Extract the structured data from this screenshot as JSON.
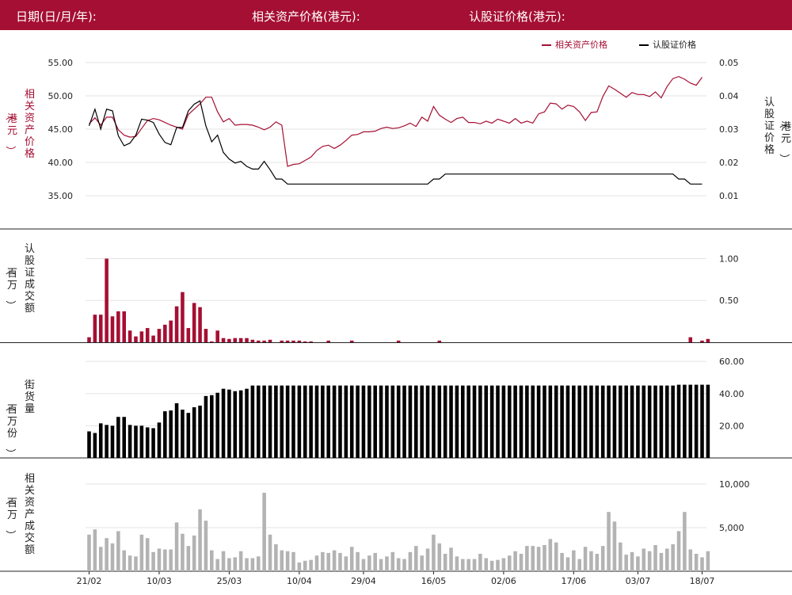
{
  "header": {
    "date_label": "日期(日/月/年):",
    "asset_label": "相关资产价格(港元):",
    "warrant_label": "认股证价格(港元):"
  },
  "colors": {
    "header_bg": "#a50f33",
    "asset": "#a50f33",
    "warrant": "#000000",
    "volume_bar": "#a50f33",
    "outstanding_bar": "#000000",
    "asset_turnover_bar": "#b3b3b3"
  },
  "x_ticks": [
    "21/02",
    "10/03",
    "25/03",
    "10/04",
    "29/04",
    "16/05",
    "02/06",
    "17/06",
    "03/07",
    "18/07"
  ],
  "chart_data": [
    {
      "type": "line",
      "legend": [
        "相关资产价格",
        "认股证价格"
      ],
      "legend_position": "top-right",
      "ylabel_left": "相关资产价格（港元）",
      "ylabel_right": "认股证价格（港元）",
      "ylim_left": [
        32.5,
        55.0
      ],
      "ylim_right": [
        0.005,
        0.05
      ],
      "yticks_left": [
        "55.00",
        "50.00",
        "45.00",
        "40.00",
        "35.00"
      ],
      "yticks_right": [
        "0.05",
        "0.04",
        "0.03",
        "0.02",
        "0.01"
      ],
      "series": [
        {
          "name": "相关资产价格",
          "axis": "left",
          "values": [
            45.8,
            46.7,
            45.6,
            46.8,
            46.8,
            44.9,
            44.1,
            43.8,
            43.9,
            45.1,
            46.3,
            46.6,
            46.4,
            46.0,
            45.6,
            45.3,
            45.0,
            47.2,
            48.0,
            48.8,
            49.8,
            49.8,
            47.6,
            46.1,
            46.6,
            45.6,
            45.7,
            45.7,
            45.6,
            45.3,
            44.9,
            45.3,
            46.1,
            45.6,
            39.4,
            39.7,
            39.8,
            40.3,
            40.8,
            41.8,
            42.4,
            42.6,
            42.1,
            42.6,
            43.3,
            44.1,
            44.2,
            44.6,
            44.6,
            44.7,
            45.1,
            45.3,
            45.1,
            45.2,
            45.5,
            45.9,
            45.4,
            46.8,
            46.2,
            48.4,
            47.1,
            46.5,
            46.0,
            46.6,
            46.8,
            46.0,
            46.0,
            45.8,
            46.2,
            45.9,
            46.5,
            46.2,
            45.9,
            46.6,
            45.9,
            46.2,
            45.9,
            47.3,
            47.6,
            48.9,
            48.8,
            48.0,
            48.6,
            48.4,
            47.6,
            46.3,
            47.5,
            47.6,
            49.9,
            51.5,
            51.0,
            50.4,
            49.8,
            50.5,
            50.2,
            50.2,
            49.9,
            50.6,
            49.7,
            51.4,
            52.6,
            52.9,
            52.5,
            51.9,
            51.6,
            52.8
          ]
        },
        {
          "name": "认股证价格",
          "axis": "right",
          "values": [
            0.031,
            0.036,
            0.03,
            0.036,
            0.0355,
            0.028,
            0.025,
            0.0258,
            0.0282,
            0.033,
            0.0327,
            0.032,
            0.0285,
            0.026,
            0.0253,
            0.0305,
            0.0305,
            0.0355,
            0.0375,
            0.0385,
            0.031,
            0.0262,
            0.0282,
            0.023,
            0.021,
            0.0198,
            0.0203,
            0.0188,
            0.018,
            0.018,
            0.0203,
            0.0178,
            0.015,
            0.015,
            0.0135,
            0.0135,
            0.0135,
            0.0135,
            0.0135,
            0.0135,
            0.0135,
            0.0135,
            0.0135,
            0.0135,
            0.0135,
            0.0135,
            0.0135,
            0.0135,
            0.0135,
            0.0135,
            0.0135,
            0.0135,
            0.0135,
            0.0135,
            0.0135,
            0.0135,
            0.0135,
            0.0135,
            0.0135,
            0.015,
            0.015,
            0.0165,
            0.0165,
            0.0165,
            0.0165,
            0.0165,
            0.0165,
            0.0165,
            0.0165,
            0.0165,
            0.0165,
            0.0165,
            0.0165,
            0.0165,
            0.0165,
            0.0165,
            0.0165,
            0.0165,
            0.0165,
            0.0165,
            0.0165,
            0.0165,
            0.0165,
            0.0165,
            0.0165,
            0.0165,
            0.0165,
            0.0165,
            0.0165,
            0.0165,
            0.0165,
            0.0165,
            0.0165,
            0.0165,
            0.0165,
            0.0165,
            0.0165,
            0.0165,
            0.0165,
            0.0165,
            0.0165,
            0.015,
            0.015,
            0.0135,
            0.0135,
            0.0135
          ]
        }
      ]
    },
    {
      "type": "bar",
      "ylabel": "认股证成交额（百万）",
      "ylim": [
        0,
        1.08
      ],
      "yticks": [
        "1.00",
        "0.50"
      ],
      "series": [
        {
          "name": "认股证成交额",
          "values": [
            0.06,
            0.33,
            0.33,
            1.0,
            0.31,
            0.37,
            0.37,
            0.14,
            0.07,
            0.13,
            0.17,
            0.08,
            0.16,
            0.21,
            0.26,
            0.43,
            0.6,
            0.17,
            0.47,
            0.42,
            0.16,
            0.01,
            0.14,
            0.05,
            0.04,
            0.05,
            0.05,
            0.05,
            0.03,
            0.02,
            0.02,
            0.03,
            0,
            0.02,
            0.02,
            0.02,
            0.02,
            0.01,
            0.01,
            0,
            0,
            0.02,
            0,
            0,
            0,
            0.02,
            0,
            0,
            0,
            0,
            0,
            0,
            0,
            0.02,
            0,
            0,
            0,
            0,
            0,
            0,
            0.02,
            0,
            0,
            0,
            0,
            0,
            0,
            0,
            0,
            0,
            0,
            0,
            0,
            0,
            0,
            0,
            0,
            0,
            0,
            0,
            0,
            0,
            0,
            0,
            0,
            0,
            0,
            0,
            0,
            0,
            0,
            0,
            0,
            0,
            0,
            0,
            0,
            0,
            0,
            0,
            0,
            0,
            0,
            0.06,
            0,
            0.02,
            0.04,
            0
          ]
        }
      ]
    },
    {
      "type": "bar",
      "ylabel": "街货量（百万份）",
      "ylim": [
        0,
        65
      ],
      "yticks": [
        "60.00",
        "40.00",
        "20.00"
      ],
      "series": [
        {
          "name": "街货量",
          "values": [
            16.5,
            15.5,
            21.5,
            20.5,
            20,
            25.5,
            25.5,
            20.5,
            20,
            20,
            19,
            18.5,
            22,
            29,
            29.5,
            34,
            30,
            28,
            31.5,
            32.5,
            38.5,
            39,
            40.5,
            43,
            42.5,
            41.5,
            42,
            43,
            45,
            45,
            45,
            45,
            45,
            45,
            45,
            45,
            45,
            45,
            45,
            45,
            45,
            45,
            45,
            45,
            45,
            45,
            45,
            45,
            45,
            45,
            45,
            45,
            45,
            45,
            45,
            45,
            45,
            45,
            45,
            45,
            45,
            45,
            45,
            45,
            45,
            45,
            45,
            45,
            45,
            45,
            45,
            45,
            45,
            45,
            45,
            45,
            45,
            45,
            45,
            45,
            45,
            45,
            45,
            45,
            45,
            45,
            45,
            45,
            45,
            45,
            45,
            45,
            45,
            45,
            45,
            45,
            45,
            45,
            45,
            45,
            45,
            45.5,
            45.5,
            45.5,
            45.5,
            45.5,
            45.5
          ]
        }
      ]
    },
    {
      "type": "bar",
      "ylabel": "相关资产成交额（百万）",
      "ylim": [
        0,
        11000
      ],
      "yticks": [
        "10,000",
        "5,000"
      ],
      "series": [
        {
          "name": "相关资产成交额",
          "values": [
            4200,
            4800,
            2800,
            3800,
            3200,
            4600,
            2400,
            1800,
            1700,
            4200,
            3800,
            2200,
            2600,
            2500,
            2500,
            5600,
            4300,
            2900,
            4100,
            7100,
            5800,
            2400,
            1400,
            2300,
            1500,
            1600,
            2300,
            1500,
            1500,
            1700,
            9000,
            4200,
            3100,
            2400,
            2300,
            2200,
            1000,
            1200,
            1300,
            1800,
            2200,
            2100,
            2400,
            2100,
            1700,
            2800,
            2200,
            1400,
            1800,
            2100,
            1400,
            1700,
            2200,
            1500,
            1400,
            2200,
            2900,
            1800,
            2600,
            4200,
            3200,
            2000,
            2700,
            1700,
            1400,
            1400,
            1400,
            2000,
            1500,
            1200,
            1300,
            1500,
            1800,
            2300,
            2000,
            2900,
            2900,
            2800,
            3000,
            3700,
            3300,
            2100,
            1600,
            2400,
            1400,
            2800,
            2300,
            2000,
            2900,
            6800,
            5700,
            3300,
            1900,
            2200,
            1700,
            2600,
            2300,
            3000,
            2100,
            2600,
            3100,
            4600,
            6800,
            2500,
            2000,
            1600,
            2300
          ]
        }
      ]
    }
  ]
}
